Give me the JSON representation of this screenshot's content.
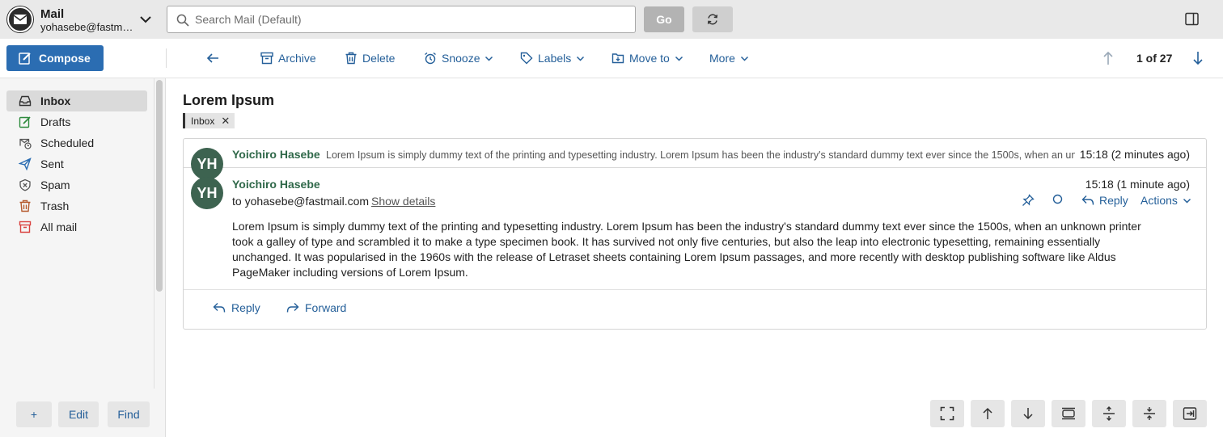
{
  "app": {
    "title": "Mail",
    "account": "yohasebe@fastmail.com"
  },
  "search": {
    "placeholder": "Search Mail (Default)",
    "value": "",
    "go_label": "Go"
  },
  "compose_label": "Compose",
  "toolbar": {
    "archive": "Archive",
    "delete": "Delete",
    "snooze": "Snooze",
    "labels": "Labels",
    "move_to": "Move to",
    "more": "More",
    "position": "1 of 27"
  },
  "sidebar": {
    "items": [
      {
        "label": "Inbox",
        "icon": "inbox-icon",
        "active": true
      },
      {
        "label": "Drafts",
        "icon": "drafts-icon"
      },
      {
        "label": "Scheduled",
        "icon": "scheduled-icon"
      },
      {
        "label": "Sent",
        "icon": "sent-icon"
      },
      {
        "label": "Spam",
        "icon": "spam-icon"
      },
      {
        "label": "Trash",
        "icon": "trash-icon"
      },
      {
        "label": "All mail",
        "icon": "all-mail-icon"
      }
    ],
    "buttons": {
      "add": "+",
      "edit": "Edit",
      "find": "Find"
    }
  },
  "thread": {
    "subject": "Lorem Ipsum",
    "label": "Inbox",
    "messages": [
      {
        "initials": "YH",
        "sender": "Yoichiro Hasebe",
        "snippet": "Lorem Ipsum is simply dummy text of the printing and typesetting industry. Lorem Ipsum has been the industry's standard dummy text ever since the 1500s, when an unknown printer took a galley of type and scrambled it",
        "time": "15:18 (2 minutes ago)"
      },
      {
        "initials": "YH",
        "sender": "Yoichiro Hasebe",
        "to": "to yohasebe@fastmail.com",
        "show_details": "Show details",
        "time": "15:18 (1 minute ago)",
        "reply": "Reply",
        "actions": "Actions",
        "body": "Lorem Ipsum is simply dummy text of the printing and typesetting industry. Lorem Ipsum has been the industry's standard dummy text ever since the 1500s, when an unknown printer took a galley of type and scrambled it to make a type specimen book. It has survived not only five centuries, but also the leap into electronic typesetting, remaining essentially unchanged. It was popularised in the 1960s with the release of Letraset sheets containing Lorem Ipsum passages, and more recently with desktop publishing software like Aldus PageMaker including versions of Lorem Ipsum."
      }
    ],
    "footer": {
      "reply": "Reply",
      "forward": "Forward"
    }
  },
  "colors": {
    "accent": "#2b6db2",
    "link": "#245f99",
    "sender": "#2f6849",
    "avatar": "#3d6350"
  }
}
